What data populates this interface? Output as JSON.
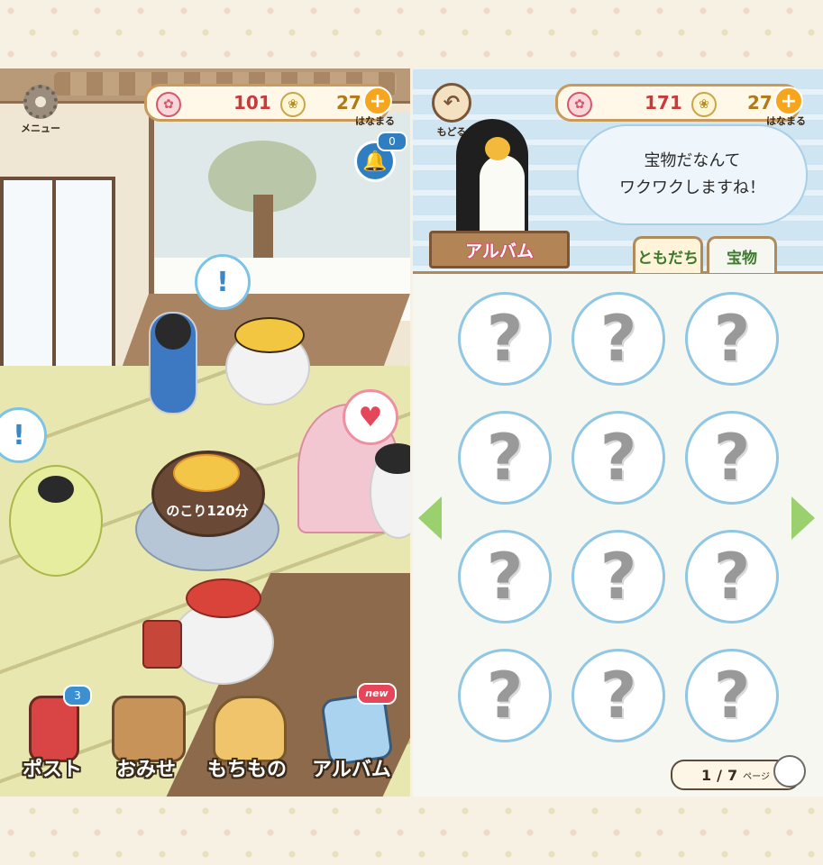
{
  "left_screen": {
    "menu_label": "メニュー",
    "currency": {
      "sakura": "101",
      "flower": "27",
      "hanamaru_label": "はなまる"
    },
    "bell_count": "0",
    "timer_text": "のこり120分",
    "bubble_icons": [
      "exclamation-icon",
      "exclamation-icon",
      "heart-icon"
    ],
    "nav": [
      {
        "label": "ポスト",
        "badge": "3",
        "icon": "mailbox-icon"
      },
      {
        "label": "おみせ",
        "icon": "shop-icon"
      },
      {
        "label": "もちもの",
        "icon": "bag-icon"
      },
      {
        "label": "アルバム",
        "badge": "new",
        "icon": "album-icon"
      }
    ]
  },
  "right_screen": {
    "back_label": "もどる",
    "currency": {
      "sakura": "171",
      "flower": "27",
      "hanamaru_label": "はなまる"
    },
    "speech_lines": [
      "宝物だなんて",
      "ワクワクしますね！"
    ],
    "sign_label": "アルバム",
    "tabs": [
      {
        "label": "ともだち",
        "active": false
      },
      {
        "label": "宝物",
        "active": true
      }
    ],
    "slot_glyph": "?",
    "pager": {
      "current": "1",
      "separator": "/",
      "total": "7",
      "unit": "ページ"
    }
  },
  "colors": {
    "accent_red": "#c73b3b",
    "slot_border": "#8fc7e4",
    "arrow_green": "#9bd06e",
    "tab_text": "#3c7b2e"
  }
}
